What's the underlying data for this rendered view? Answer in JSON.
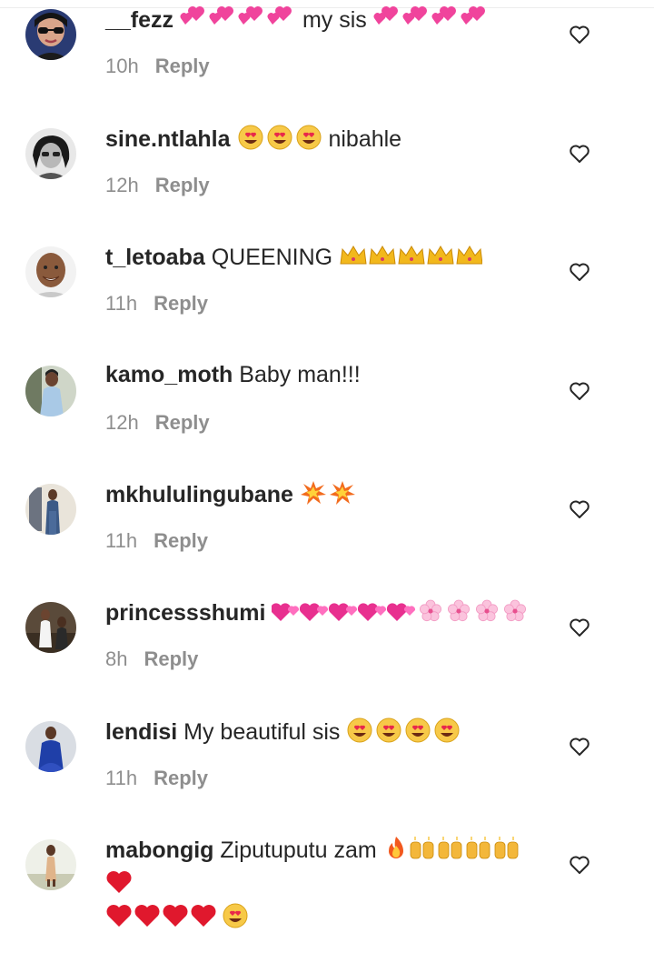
{
  "reply_label": "Reply",
  "colors": {
    "username": "#262626",
    "meta": "#8e8e8e",
    "heart_outline": "#262626"
  },
  "comments": [
    {
      "username": "__fezz",
      "pre_text": "",
      "text": "my sis",
      "emoji_before_text": "double-pink-hearts x4",
      "emoji_after_text": "double-pink-hearts x4",
      "time": "10h"
    },
    {
      "username": "sine.ntlahla",
      "text": "nibahle",
      "emoji_before_text": "heart-eyes x3",
      "time": "12h"
    },
    {
      "username": "t_letoaba",
      "text": "QUEENING",
      "emoji_after_text": "crown x5",
      "time": "11h"
    },
    {
      "username": "kamo_moth",
      "text": "Baby man!!!",
      "time": "12h"
    },
    {
      "username": "mkhululingubane",
      "text": "",
      "emoji_after_text": "collision x2",
      "time": "11h"
    },
    {
      "username": "princessshumi",
      "text": "",
      "emoji_after_text": "revolving-hearts x5, cherry-blossom x4",
      "time": "8h"
    },
    {
      "username": "lendisi",
      "text": "My beautiful sis",
      "emoji_after_text": "heart-eyes x4",
      "time": "11h"
    },
    {
      "username": "mabongig",
      "text": "Ziputuputu zam",
      "emoji_after_text": "fire, raising-hands x4, red-heart x5, heart-eyes",
      "time": ""
    }
  ]
}
